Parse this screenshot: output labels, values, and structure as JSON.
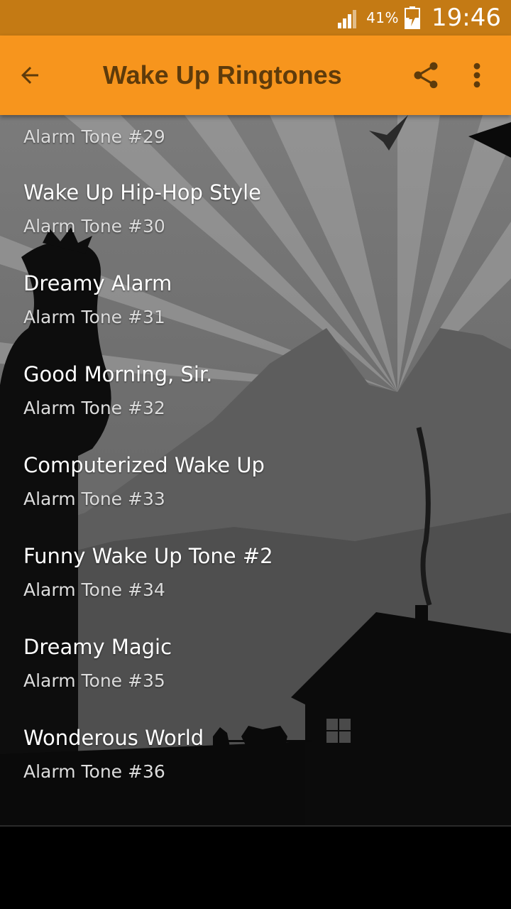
{
  "status_bar": {
    "battery_percent": "41%",
    "time": "19:46"
  },
  "app_bar": {
    "title": "Wake Up Ringtones",
    "icons": [
      "arrow-back-icon",
      "share-icon",
      "more-vert-icon"
    ]
  },
  "list": {
    "partial_top_subtitle": "Alarm Tone #29",
    "items": [
      {
        "title": "Wake Up Hip-Hop Style",
        "subtitle": "Alarm Tone #30"
      },
      {
        "title": "Dreamy Alarm",
        "subtitle": "Alarm Tone #31"
      },
      {
        "title": "Good Morning, Sir.",
        "subtitle": "Alarm Tone #32"
      },
      {
        "title": "Computerized Wake Up",
        "subtitle": "Alarm Tone #33"
      },
      {
        "title": "Funny Wake Up Tone #2",
        "subtitle": "Alarm Tone #34"
      },
      {
        "title": "Dreamy Magic",
        "subtitle": "Alarm Tone #35"
      },
      {
        "title": "Wonderous World",
        "subtitle": "Alarm Tone #36"
      }
    ]
  },
  "colors": {
    "status_bar": "#c47a14",
    "app_bar": "#f7951d",
    "title_text": "#5e3b0b"
  }
}
